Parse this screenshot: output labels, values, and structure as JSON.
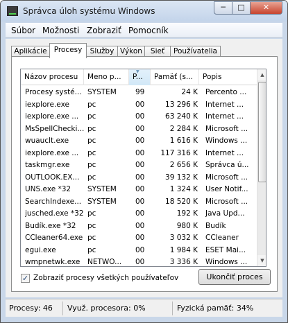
{
  "window": {
    "title": "Správca úloh systému Windows"
  },
  "controls": {
    "minimize": "─",
    "maximize": "□",
    "close": "✕"
  },
  "menu": [
    "Súbor",
    "Možnosti",
    "Zobraziť",
    "Pomocník"
  ],
  "tabs": [
    "Aplikácie",
    "Procesy",
    "Služby",
    "Výkon",
    "Sieť",
    "Používatelia"
  ],
  "active_tab": "Procesy",
  "table": {
    "columns": [
      "Názov procesu",
      "Meno p...",
      "P...",
      "Pamäť (s...",
      "Popis"
    ],
    "sorted_column": "P...",
    "rows": [
      [
        "Procesy systé...",
        "SYSTEM",
        "99",
        "24 K",
        "Percento ..."
      ],
      [
        "iexplore.exe",
        "pc",
        "00",
        "13 296 K",
        "Internet ..."
      ],
      [
        "iexplore.exe ...",
        "pc",
        "00",
        "63 240 K",
        "Internet ..."
      ],
      [
        "MsSpellChecki...",
        "pc",
        "00",
        "2 284 K",
        "Microsoft ..."
      ],
      [
        "wuauclt.exe",
        "pc",
        "00",
        "1 616 K",
        "Windows ..."
      ],
      [
        "iexplore.exe ...",
        "pc",
        "00",
        "117 316 K",
        "Internet ..."
      ],
      [
        "taskmgr.exe",
        "pc",
        "00",
        "2 656 K",
        "Správca ú..."
      ],
      [
        "OUTLOOK.EX...",
        "pc",
        "00",
        "39 132 K",
        "Microsoft ..."
      ],
      [
        "UNS.exe *32",
        "SYSTEM",
        "00",
        "1 324 K",
        "User Notif..."
      ],
      [
        "SearchIndexe...",
        "SYSTEM",
        "00",
        "18 520 K",
        "Microsoft ..."
      ],
      [
        "jusched.exe *32",
        "pc",
        "00",
        "192 K",
        "Java Upd..."
      ],
      [
        "Budík.exe *32",
        "pc",
        "00",
        "980 K",
        "Budík"
      ],
      [
        "CCleaner64.exe",
        "pc",
        "00",
        "3 032 K",
        "CCleaner"
      ],
      [
        "egui.exe",
        "pc",
        "00",
        "1 984 K",
        "ESET Mai..."
      ],
      [
        "wmpnetwk.exe",
        "NETWO...",
        "00",
        "3 336 K",
        "Windows ..."
      ]
    ]
  },
  "show_all_processes": {
    "label": "Zobraziť procesy všetkých používateľov",
    "checked": true,
    "mark": "✓"
  },
  "end_process_button": "Ukončiť proces",
  "status": {
    "processes": "Procesy: 46",
    "cpu": "Využ. procesora: 0%",
    "memory": "Fyzická pamäť: 34%"
  }
}
